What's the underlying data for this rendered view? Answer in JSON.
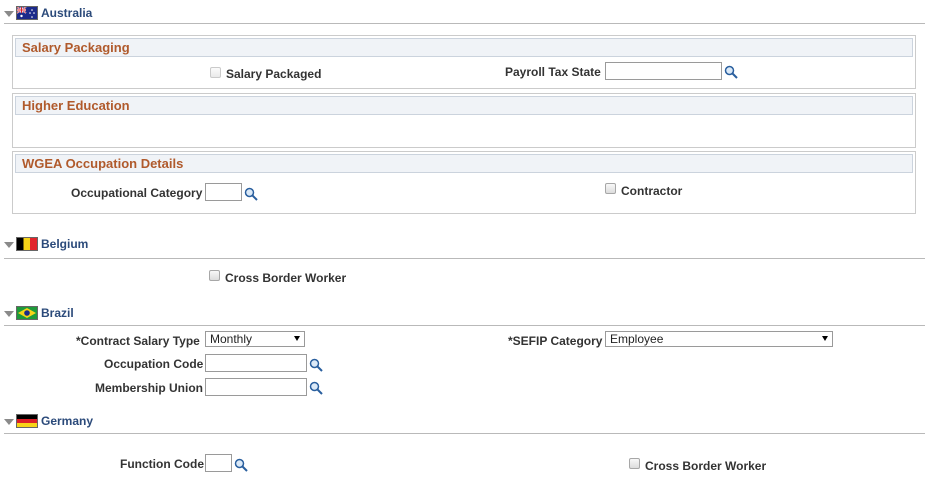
{
  "countries": {
    "australia": {
      "name": "Australia"
    },
    "belgium": {
      "name": "Belgium"
    },
    "brazil": {
      "name": "Brazil"
    },
    "germany": {
      "name": "Germany"
    }
  },
  "australia": {
    "salary_packaging": {
      "title": "Salary Packaging",
      "salary_packaged_label": "Salary Packaged",
      "payroll_tax_state_label": "Payroll Tax State",
      "payroll_tax_state_value": ""
    },
    "higher_education": {
      "title": "Higher Education"
    },
    "wgea": {
      "title": "WGEA Occupation Details",
      "occupational_category_label": "Occupational Category",
      "occupational_category_value": "",
      "contractor_label": "Contractor"
    }
  },
  "belgium": {
    "cross_border_worker_label": "Cross Border Worker"
  },
  "brazil": {
    "contract_salary_type_label": "*Contract Salary Type",
    "contract_salary_type_value": "Monthly",
    "sefip_category_label": "*SEFIP Category",
    "sefip_category_value": "Employee",
    "occupation_code_label": "Occupation Code",
    "occupation_code_value": "",
    "membership_union_label": "Membership Union",
    "membership_union_value": ""
  },
  "germany": {
    "function_code_label": "Function Code",
    "function_code_value": "",
    "cross_border_worker_label": "Cross Border Worker"
  },
  "icons": {
    "lookup": "magnifier-icon",
    "collapse": "collapse-triangle-icon"
  }
}
